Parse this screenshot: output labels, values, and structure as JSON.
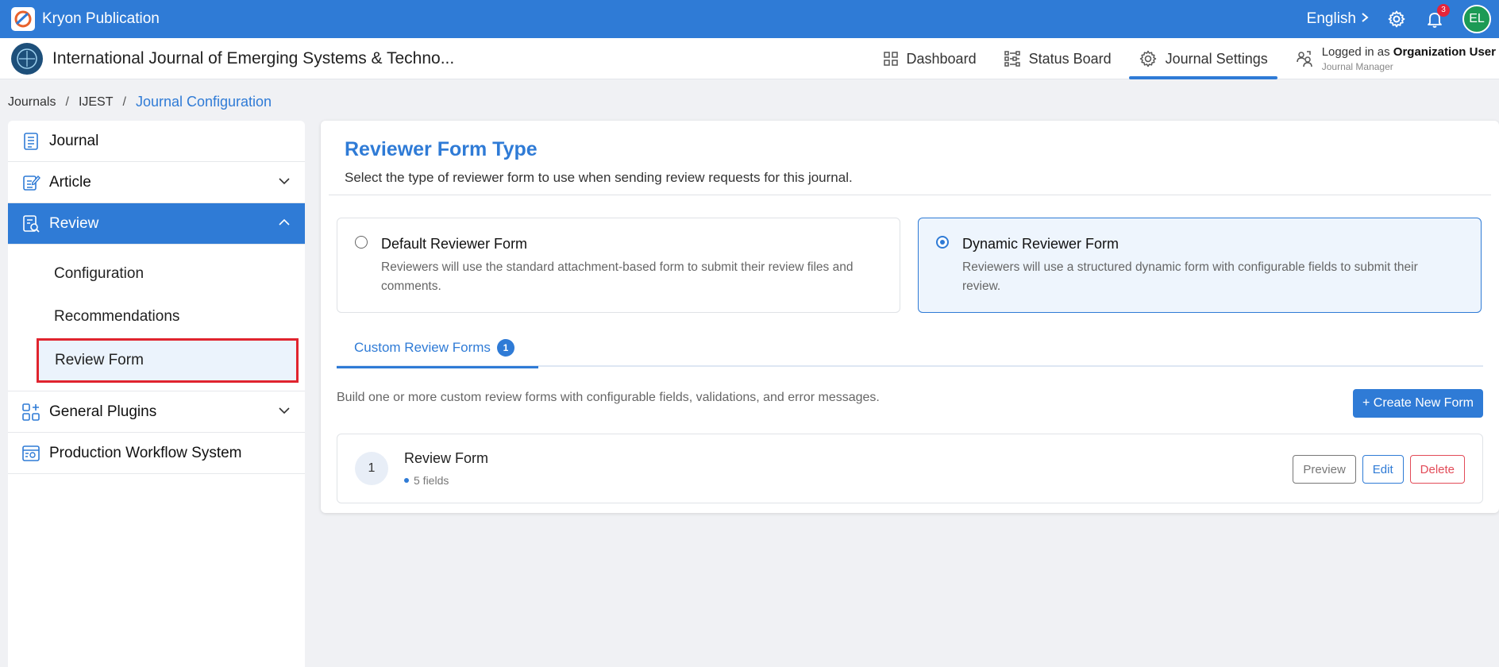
{
  "topbar": {
    "app_name": "Kryon Publication",
    "language": "English",
    "notification_count": "3",
    "avatar_initials": "EL"
  },
  "header": {
    "journal_title": "International Journal of Emerging Systems & Techno...",
    "nav": [
      {
        "label": "Dashboard"
      },
      {
        "label": "Status Board"
      },
      {
        "label": "Journal Settings"
      }
    ],
    "logged_in_prefix": "Logged in as",
    "logged_in_user": "Organization User",
    "role": "Journal Manager"
  },
  "breadcrumb": {
    "items": [
      "Journals",
      "IJEST"
    ],
    "current": "Journal Configuration"
  },
  "sidebar": {
    "items": [
      {
        "label": "Journal"
      },
      {
        "label": "Article"
      },
      {
        "label": "Review"
      },
      {
        "label": "General Plugins"
      },
      {
        "label": "Production Workflow System"
      }
    ],
    "review_sub": [
      {
        "label": "Configuration"
      },
      {
        "label": "Recommendations"
      },
      {
        "label": "Review Form"
      }
    ]
  },
  "main": {
    "title": "Reviewer Form Type",
    "description": "Select the type of reviewer form to use when sending review requests for this journal.",
    "options": [
      {
        "title": "Default Reviewer Form",
        "description": "Reviewers will use the standard attachment-based form to submit their review files and comments.",
        "selected": false
      },
      {
        "title": "Dynamic Reviewer Form",
        "description": "Reviewers will use a structured dynamic form with configurable fields to submit their review.",
        "selected": true
      }
    ],
    "tab_label": "Custom Review Forms",
    "tab_count": "1",
    "build_description": "Build one or more custom review forms with configurable fields, validations, and error messages.",
    "create_button": "+ Create New Form",
    "forms": [
      {
        "number": "1",
        "name": "Review Form",
        "fields": "5 fields"
      }
    ],
    "preview_label": "Preview",
    "edit_label": "Edit",
    "delete_label": "Delete"
  },
  "colors": {
    "accent": "#2f7bd6",
    "highlight_border": "#e0242e",
    "danger": "#e24b58",
    "avatar": "#1c9a55"
  }
}
